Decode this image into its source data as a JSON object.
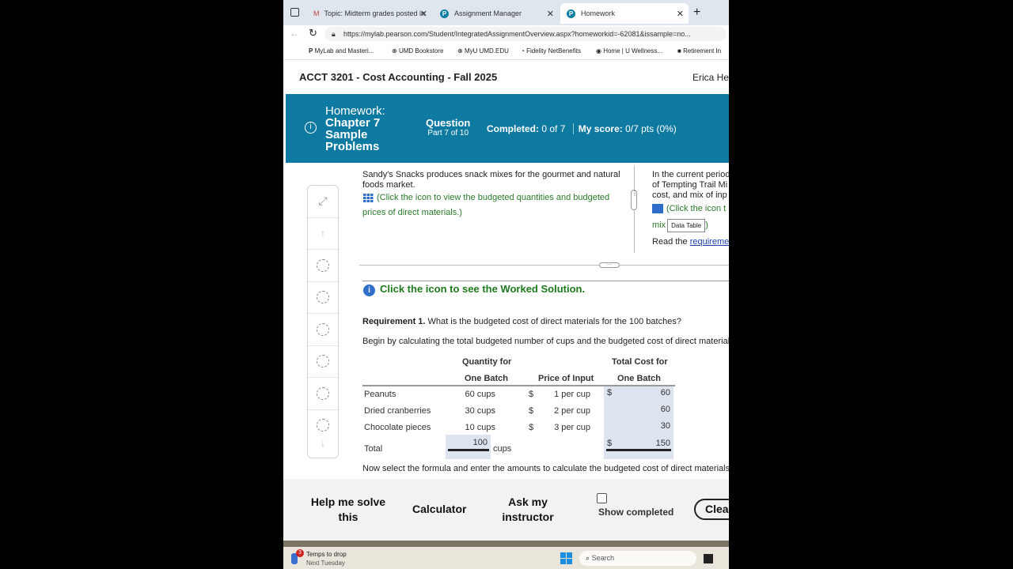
{
  "browser": {
    "tabs": [
      {
        "label": "Topic: Midterm grades posted in"
      },
      {
        "label": "Assignment Manager"
      },
      {
        "label": "Homework",
        "active": true
      }
    ],
    "url": "https://mylab.pearson.com/Student/IntegratedAssignmentOverview.aspx?homeworkid=-62081&issample=no...",
    "bookmarks": [
      "MyLab and Masteri...",
      "UMD Bookstore",
      "MyU UMD.EDU",
      "Fidelity NetBenefits",
      "Home | U Wellness...",
      "Retirement In"
    ]
  },
  "header": {
    "course": "ACCT 3201 - Cost Accounting - Fall 2025",
    "user": "Erica He"
  },
  "banner": {
    "homework_label": "Homework:",
    "title_lines": [
      "Chapter 7",
      "Sample",
      "Problems"
    ],
    "question_label": "Question",
    "part": "Part 7 of 10",
    "completed_label": "Completed:",
    "completed_value": "0 of 7",
    "score_label": "My score:",
    "score_value": "0/7 pts (0%)"
  },
  "left_pane": {
    "text": "Sandy's Snacks produces snack mixes for the gourmet and natural foods market.",
    "link": "(Click the icon to view the budgeted quantities and budgeted prices of direct materials.)"
  },
  "right_pane": {
    "lines": [
      "In the current period",
      "of Tempting Trail Mi",
      "cost, and mix of inp"
    ],
    "link": "(Click the icon t",
    "link2": "mix",
    "tooltip": "Data Table",
    "close": ")",
    "read": "Read the ",
    "req_link": "requireme"
  },
  "worked_solution": "Click the icon to see the Worked Solution.",
  "requirement": {
    "label": "Requirement 1.",
    "text": "What is the budgeted cost of direct materials for the 100 batches?"
  },
  "instruction": "Begin by calculating the total budgeted number of cups and the budgeted cost of direct materials",
  "table": {
    "headers": {
      "qty1": "Quantity for",
      "qty2": "One Batch",
      "price": "Price of Input",
      "cost1": "Total Cost for",
      "cost2": "One Batch"
    },
    "rows": [
      {
        "name": "Peanuts",
        "qty": "60 cups",
        "cur": "$",
        "price": "1 per cup",
        "cost_cur": "$",
        "cost": "60"
      },
      {
        "name": "Dried cranberries",
        "qty": "30 cups",
        "cur": "$",
        "price": "2 per cup",
        "cost_cur": "",
        "cost": "60"
      },
      {
        "name": "Chocolate pieces",
        "qty": "10 cups",
        "cur": "$",
        "price": "3 per cup",
        "cost_cur": "",
        "cost": "30"
      }
    ],
    "total": {
      "name": "Total",
      "qty": "100",
      "unit": "cups",
      "cost_cur": "$",
      "cost": "150"
    }
  },
  "next_instruction": "Now select the formula and enter the amounts to calculate the budgeted cost of direct materials",
  "bottom": {
    "help": "Help me solve this",
    "calculator": "Calculator",
    "ask": "Ask my instructor",
    "show_completed": "Show completed",
    "clear": "Clear"
  },
  "taskbar": {
    "weather_title": "Temps to drop",
    "weather_sub": "Next Tuesday",
    "badge": "3",
    "search": "Search"
  }
}
